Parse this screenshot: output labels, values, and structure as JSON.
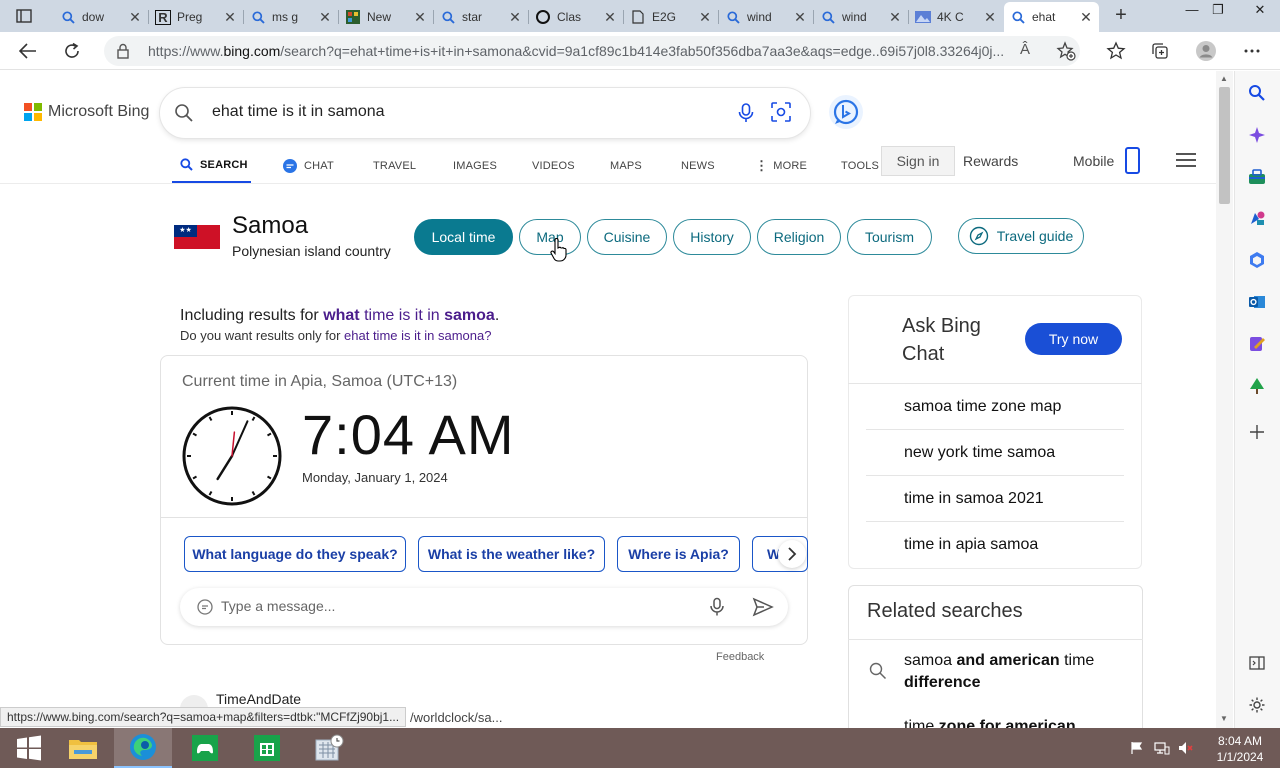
{
  "browser": {
    "tabs": [
      {
        "title": "dow",
        "icon": "search-icon"
      },
      {
        "title": "Preg",
        "icon": "r-icon"
      },
      {
        "title": "ms g",
        "icon": "search-icon"
      },
      {
        "title": "New",
        "icon": "app-icon"
      },
      {
        "title": "star",
        "icon": "search-icon"
      },
      {
        "title": "Clas",
        "icon": "circle-icon"
      },
      {
        "title": "E2G",
        "icon": "doc-icon"
      },
      {
        "title": "wind",
        "icon": "search-icon"
      },
      {
        "title": "wind",
        "icon": "search-icon"
      },
      {
        "title": "4K C",
        "icon": "image-icon"
      },
      {
        "title": "ehat",
        "icon": "search-icon"
      }
    ],
    "url_prefix": "https://www.",
    "url_domain": "bing.com",
    "url_rest": "/search?q=ehat+time+is+it+in+samona&cvid=9a1cf89c1b414e3fab50f356dba7aa3e&aqs=edge..69i57j0l8.33264j0j...",
    "read_aloud": "Â"
  },
  "bing": {
    "logo_text": "Microsoft Bing",
    "query": "ehat time is it in samona",
    "scopes": [
      {
        "label": "SEARCH"
      },
      {
        "label": "CHAT"
      },
      {
        "label": "TRAVEL"
      },
      {
        "label": "IMAGES"
      },
      {
        "label": "VIDEOS"
      },
      {
        "label": "MAPS"
      },
      {
        "label": "NEWS"
      },
      {
        "label": "MORE"
      },
      {
        "label": "TOOLS"
      }
    ],
    "sign_in": "Sign in",
    "rewards": "Rewards",
    "mobile": "Mobile"
  },
  "entity": {
    "title": "Samoa",
    "subtitle": "Polynesian island country",
    "pills": [
      "Local time",
      "Map",
      "Cuisine",
      "History",
      "Religion",
      "Tourism"
    ],
    "travel_guide": "Travel guide"
  },
  "results": {
    "including_prefix": "Including results for ",
    "including_what": "what",
    "including_mid": " time is it in ",
    "including_samoa": "samoa",
    "including_dot": ".",
    "didyou_prefix": "Do you want results only for ",
    "didyou_link": "ehat time is it in samona",
    "didyou_q": "?",
    "time_caption": "Current time in Apia, Samoa (UTC+13)",
    "time": "7:04 AM",
    "date": "Monday, January 1, 2024",
    "chips": [
      "What language do they speak?",
      "What is the weather like?",
      "Where is Apia?",
      "W"
    ],
    "message_placeholder": "Type a message...",
    "feedback": "Feedback",
    "first_result_site": "TimeAndDate",
    "first_result_url": "/worldclock/sa...",
    "status_url": "https://www.bing.com/search?q=samoa+map&filters=dtbk:\"MCFfZj90bj1..."
  },
  "side": {
    "ask_title": "Ask Bing Chat",
    "try_now": "Try now",
    "suggestions": [
      "samoa time zone map",
      "new york time samoa",
      "time in samoa 2021",
      "time in apia samoa"
    ],
    "related_title": "Related searches",
    "related_1_a": "samoa ",
    "related_1_b": "and american",
    "related_1_c": " time",
    "related_1_d": "difference",
    "related_2_a": "time ",
    "related_2_b": "zone for american"
  },
  "taskbar": {
    "time": "8:04 AM",
    "date": "1/1/2024"
  },
  "colors": {
    "accent": "#174ae4",
    "teal": "#0a7a90",
    "visited": "#4b1d8c"
  }
}
